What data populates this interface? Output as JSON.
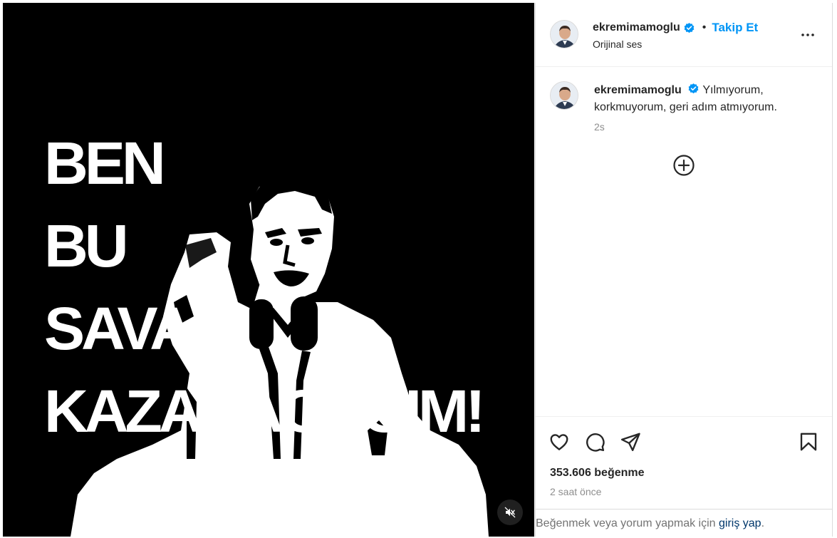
{
  "post": {
    "media": {
      "headline_lines": [
        "BEN",
        "BU",
        "SAVAŞI",
        "KAZANACAĞIM!"
      ],
      "mute_icon": "speaker-muted-icon",
      "description": "black and white high-contrast silhouette of a man speaking at microphones with raised fist"
    },
    "header": {
      "username": "ekremimamoglu",
      "verified_icon": "verified-badge-icon",
      "separator": "•",
      "follow_label": "Takip Et",
      "audio_label": "Orijinal ses",
      "more_icon": "more-horizontal-icon"
    },
    "caption": {
      "username": "ekremimamoglu",
      "text": "Yılmıyorum, korkmuyorum, geri adım atmıyorum.",
      "time": "2s",
      "load_more_icon": "plus-circle-icon"
    },
    "actions": {
      "like_icon": "heart-icon",
      "comment_icon": "comment-icon",
      "share_icon": "paper-plane-icon",
      "save_icon": "bookmark-icon",
      "likes_text": "353.606 beğenme",
      "time_ago": "2 saat önce"
    },
    "login_prompt": {
      "prefix": "Beğenmek veya yorum yapmak için ",
      "link": "giriş yap",
      "suffix": "."
    },
    "colors": {
      "accent": "#0095f6",
      "link": "#00376b",
      "muted": "#8e8e8e",
      "verified": "#0095f6"
    }
  }
}
